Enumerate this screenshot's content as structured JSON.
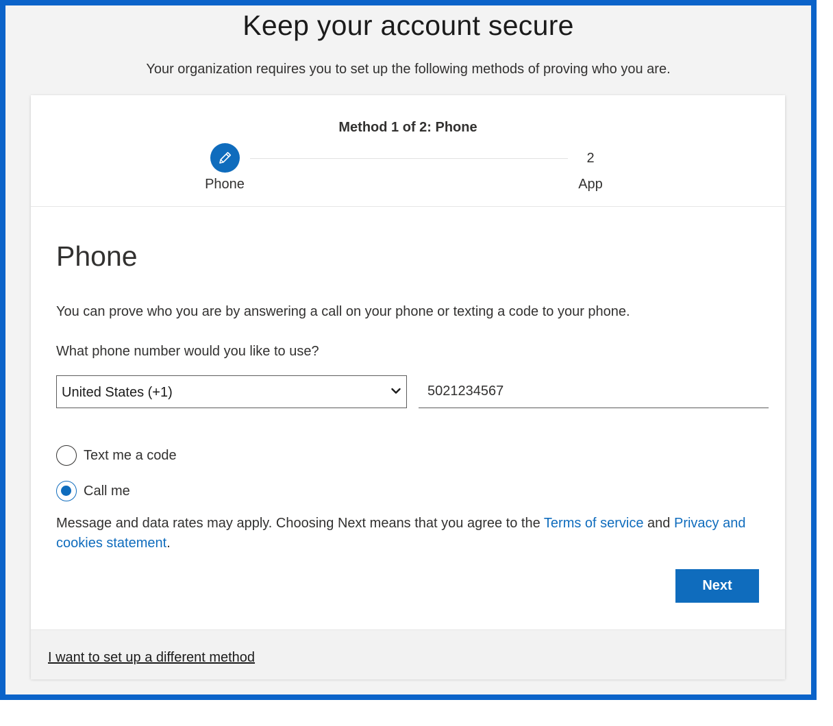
{
  "header": {
    "title": "Keep your account secure",
    "subtitle": "Your organization requires you to set up the following methods of proving who you are."
  },
  "progress": {
    "heading": "Method 1 of 2: Phone",
    "steps": [
      {
        "label": "Phone",
        "status": "current",
        "icon": "pencil-icon"
      },
      {
        "number": "2",
        "label": "App",
        "status": "upcoming"
      }
    ]
  },
  "phone": {
    "title": "Phone",
    "description": "You can prove who you are by answering a call on your phone or texting a code to your phone.",
    "question": "What phone number would you like to use?",
    "country": {
      "selected": "United States (+1)"
    },
    "number_value": "5021234567",
    "options": [
      {
        "label": "Text me a code",
        "checked": false
      },
      {
        "label": "Call me",
        "checked": true
      }
    ],
    "disclaimer": {
      "prefix": "Message and data rates may apply. Choosing Next means that you agree to the ",
      "terms_link": "Terms of service",
      "middle": " and ",
      "privacy_link": "Privacy and cookies statement",
      "suffix": "."
    },
    "next_label": "Next"
  },
  "footer": {
    "different_method_link": "I want to set up a different method"
  },
  "colors": {
    "accent": "#0f6cbd",
    "frame_border": "#0b63c9"
  }
}
